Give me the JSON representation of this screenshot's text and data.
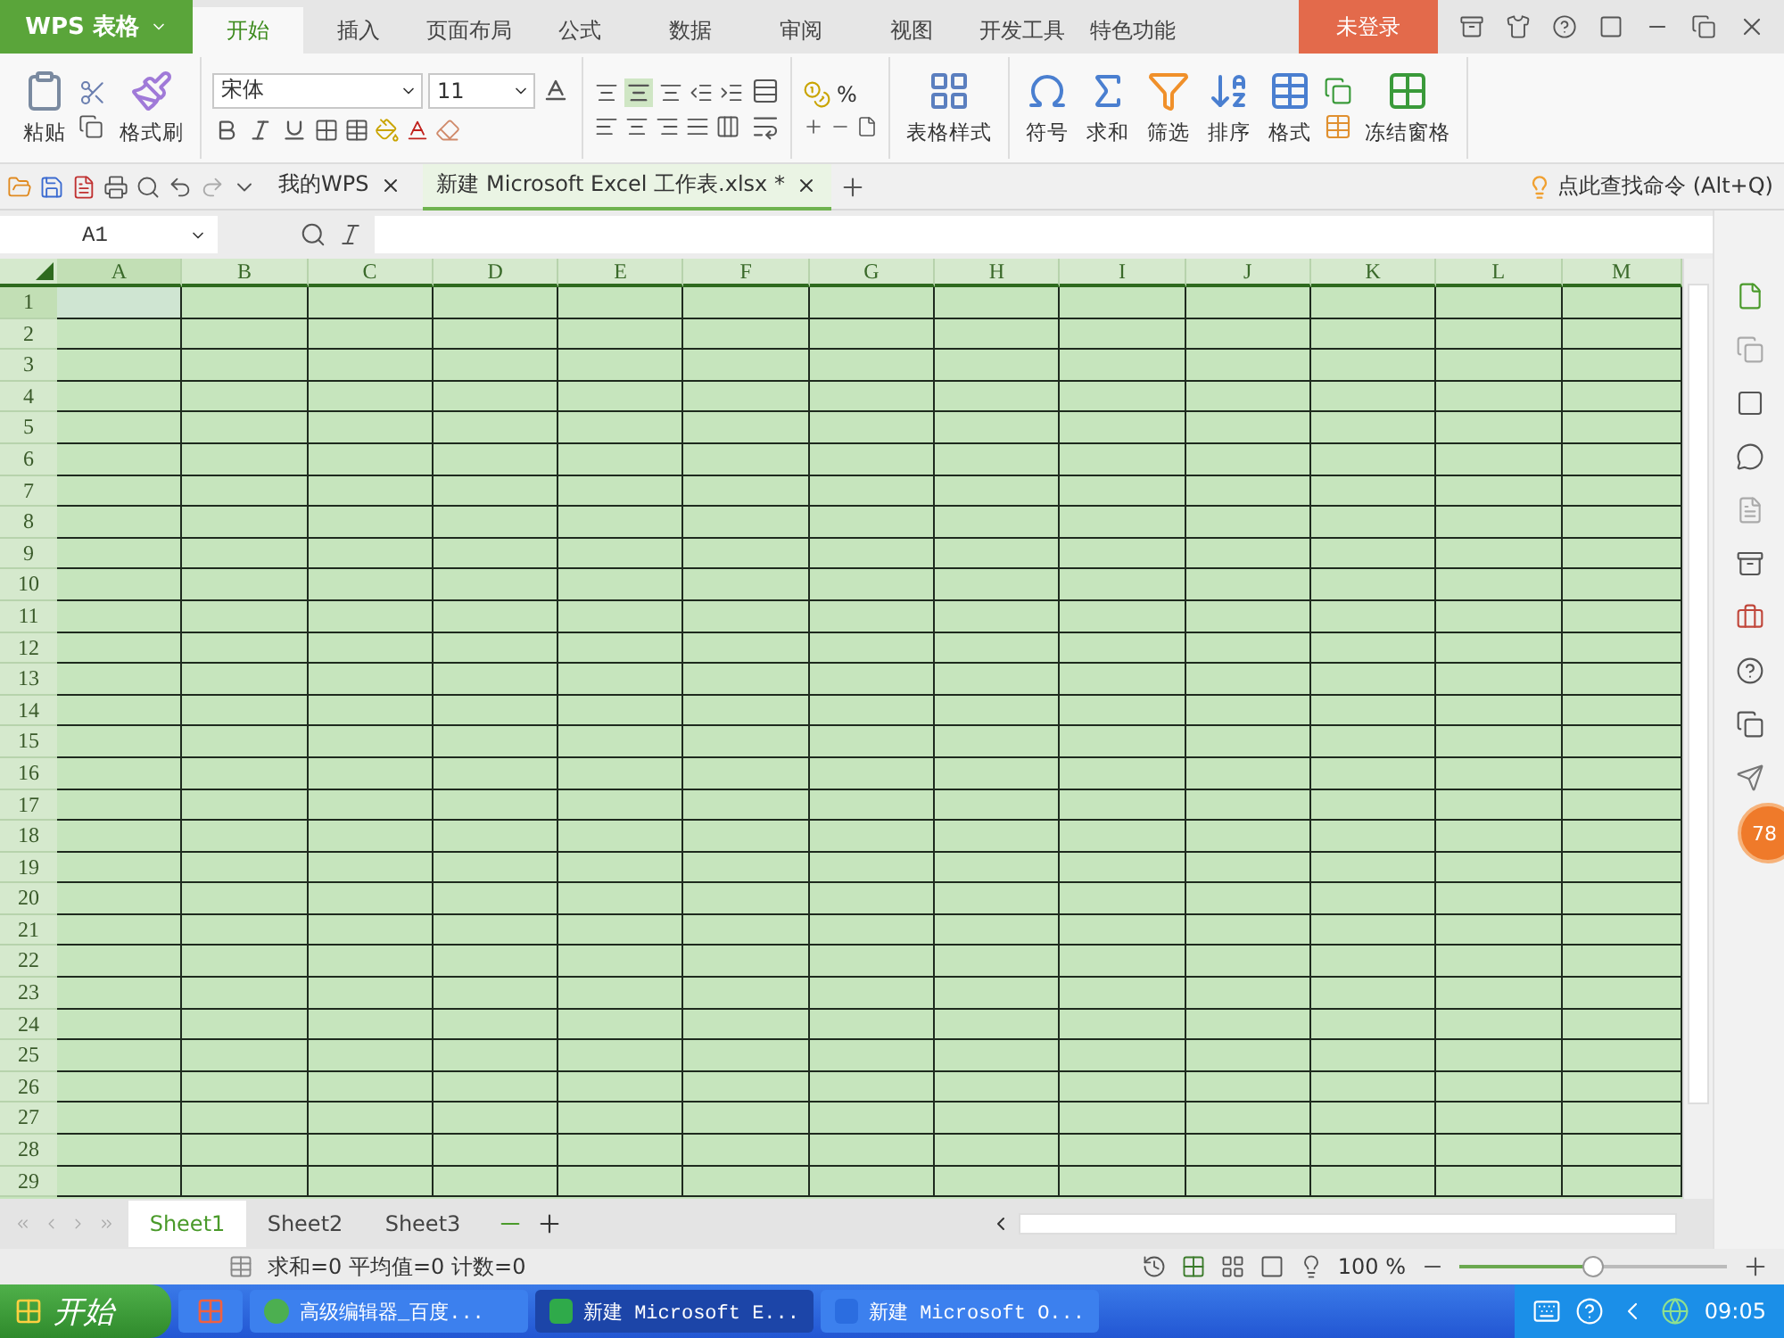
{
  "app": {
    "name": "WPS 表格"
  },
  "ribbon_tabs": [
    {
      "label": "开始",
      "selected": true
    },
    {
      "label": "插入",
      "selected": false
    },
    {
      "label": "页面布局",
      "selected": false
    },
    {
      "label": "公式",
      "selected": false
    },
    {
      "label": "数据",
      "selected": false
    },
    {
      "label": "审阅",
      "selected": false
    },
    {
      "label": "视图",
      "selected": false
    },
    {
      "label": "开发工具",
      "selected": false
    },
    {
      "label": "特色功能",
      "selected": false
    }
  ],
  "login_button": "未登录",
  "ribbon": {
    "paste": "粘贴",
    "format_painter": "格式刷",
    "font_name": "宋体",
    "font_size": "11",
    "percent": "%",
    "table_style": "表格样式",
    "symbol": "符号",
    "sum": "求和",
    "filter": "筛选",
    "sort": "排序",
    "format": "格式",
    "freeze": "冻结窗格"
  },
  "doc_tabs": [
    {
      "label": "我的WPS",
      "selected": false
    },
    {
      "label": "新建 Microsoft Excel 工作表.xlsx *",
      "selected": true
    }
  ],
  "command_search": {
    "placeholder": "点此查找命令 (Alt+Q)"
  },
  "name_box": "A1",
  "columns": [
    {
      "label": "A",
      "selected": true
    },
    {
      "label": "B",
      "selected": false
    },
    {
      "label": "C",
      "selected": false
    },
    {
      "label": "D",
      "selected": false
    },
    {
      "label": "E",
      "selected": false
    },
    {
      "label": "F",
      "selected": false
    },
    {
      "label": "G",
      "selected": false
    },
    {
      "label": "H",
      "selected": false
    },
    {
      "label": "I",
      "selected": false
    },
    {
      "label": "J",
      "selected": false
    },
    {
      "label": "K",
      "selected": false
    },
    {
      "label": "L",
      "selected": false
    },
    {
      "label": "M",
      "selected": false
    }
  ],
  "rows": [
    {
      "label": "1",
      "selected": true
    },
    {
      "label": "2",
      "selected": false
    },
    {
      "label": "3",
      "selected": false
    },
    {
      "label": "4",
      "selected": false
    },
    {
      "label": "5",
      "selected": false
    },
    {
      "label": "6",
      "selected": false
    },
    {
      "label": "7",
      "selected": false
    },
    {
      "label": "8",
      "selected": false
    },
    {
      "label": "9",
      "selected": false
    },
    {
      "label": "10",
      "selected": false
    },
    {
      "label": "11",
      "selected": false
    },
    {
      "label": "12",
      "selected": false
    },
    {
      "label": "13",
      "selected": false
    },
    {
      "label": "14",
      "selected": false
    },
    {
      "label": "15",
      "selected": false
    },
    {
      "label": "16",
      "selected": false
    },
    {
      "label": "17",
      "selected": false
    },
    {
      "label": "18",
      "selected": false
    },
    {
      "label": "19",
      "selected": false
    },
    {
      "label": "20",
      "selected": false
    },
    {
      "label": "21",
      "selected": false
    },
    {
      "label": "22",
      "selected": false
    },
    {
      "label": "23",
      "selected": false
    },
    {
      "label": "24",
      "selected": false
    },
    {
      "label": "25",
      "selected": false
    },
    {
      "label": "26",
      "selected": false
    },
    {
      "label": "27",
      "selected": false
    },
    {
      "label": "28",
      "selected": false
    },
    {
      "label": "29",
      "selected": false
    }
  ],
  "sheets": [
    {
      "label": "Sheet1",
      "selected": true
    },
    {
      "label": "Sheet2",
      "selected": false
    },
    {
      "label": "Sheet3",
      "selected": false
    }
  ],
  "sidebar_badge": "78",
  "status": {
    "summary": "求和=0 平均值=0 计数=0",
    "zoom": "100 %",
    "zoom_slider": {
      "level": 0.5
    }
  },
  "taskbar": {
    "start": "开始",
    "windows": [
      {
        "label": "高级编辑器_百度...",
        "selected": false,
        "kind": "browser"
      },
      {
        "label": "新建 Microsoft E...",
        "selected": true,
        "kind": "sheet"
      },
      {
        "label": "新建 Microsoft O...",
        "selected": false,
        "kind": "writer"
      }
    ],
    "clock": "09:05"
  }
}
